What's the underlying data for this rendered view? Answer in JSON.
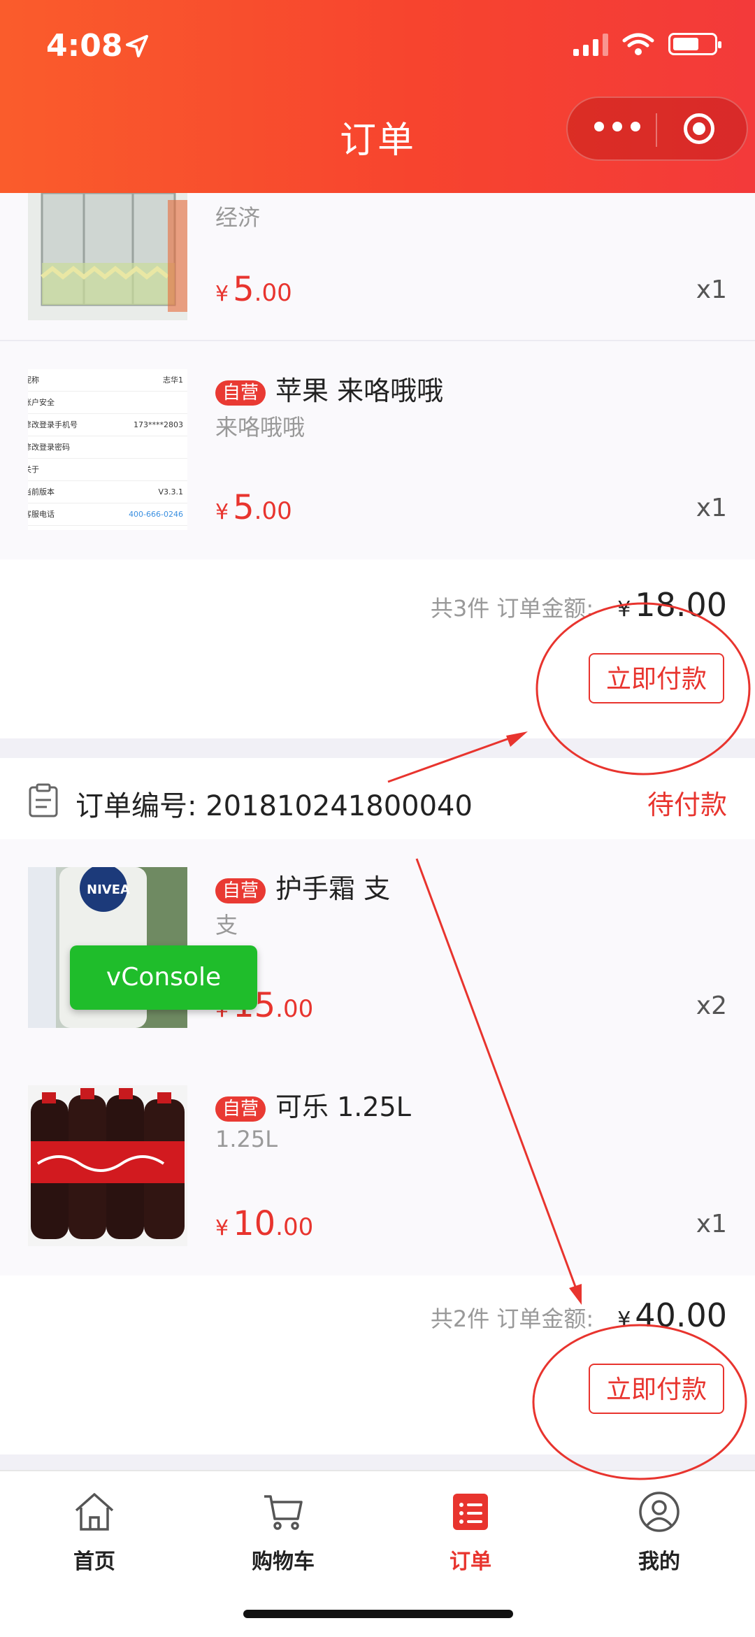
{
  "status_bar": {
    "time": "4:08"
  },
  "header": {
    "title": "订单"
  },
  "orders": [
    {
      "items": [
        {
          "name": "",
          "spec": "经济",
          "price_currency": "¥",
          "price_int": "5",
          "price_dec": ".00",
          "qty": "x1"
        },
        {
          "badge": "自营",
          "name": "苹果 来咯哦哦",
          "spec": "来咯哦哦",
          "price_currency": "¥",
          "price_int": "5",
          "price_dec": ".00",
          "qty": "x1"
        }
      ],
      "summary": {
        "count_label": "共3件",
        "amount_label": "订单金额:",
        "currency": "¥",
        "amount": "18.00"
      },
      "pay_button": "立即付款"
    },
    {
      "order_label": "订单编号:",
      "order_no": "201810241800040",
      "status": "待付款",
      "items": [
        {
          "badge": "自营",
          "name": "护手霜 支",
          "spec": "支",
          "price_currency": "¥",
          "price_int": "15",
          "price_dec": ".00",
          "qty": "x2"
        },
        {
          "badge": "自营",
          "name": "可乐 1.25L",
          "spec": "1.25L",
          "price_currency": "¥",
          "price_int": "10",
          "price_dec": ".00",
          "qty": "x1"
        }
      ],
      "summary": {
        "count_label": "共2件",
        "amount_label": "订单金额:",
        "currency": "¥",
        "amount": "40.00"
      },
      "pay_button": "立即付款"
    }
  ],
  "thumbnail_settings_rows": [
    {
      "label": "昵称",
      "value": "志华1"
    },
    {
      "label": "账户安全",
      "value": ""
    },
    {
      "label": "修改登录手机号",
      "value": "173****2803"
    },
    {
      "label": "修改登录密码",
      "value": ""
    },
    {
      "label": "关于",
      "value": ""
    },
    {
      "label": "当前版本",
      "value": "V3.3.1"
    },
    {
      "label": "客服电话",
      "value": "400-666-0246"
    }
  ],
  "vconsole": {
    "label": "vConsole"
  },
  "tabbar": {
    "items": [
      {
        "label": "首页",
        "icon": "home-icon",
        "active": false
      },
      {
        "label": "购物车",
        "icon": "cart-icon",
        "active": false
      },
      {
        "label": "订单",
        "icon": "order-list-icon",
        "active": true
      },
      {
        "label": "我的",
        "icon": "profile-icon",
        "active": false
      }
    ]
  },
  "colors": {
    "accent": "#e8342e",
    "header_start": "#fa5c2c",
    "header_end": "#f33a3a",
    "vconsole": "#1fbd2b"
  }
}
